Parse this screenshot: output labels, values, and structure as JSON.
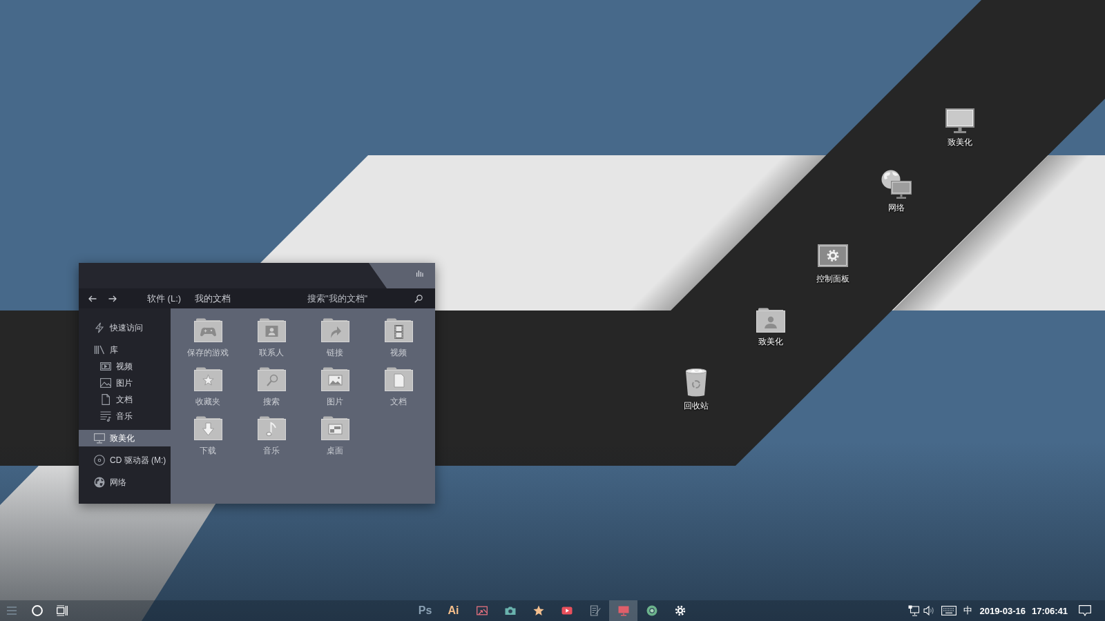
{
  "desktop": {
    "icons": [
      {
        "label": "致美化",
        "kind": "computer"
      },
      {
        "label": "网络",
        "kind": "network"
      },
      {
        "label": "控制面板",
        "kind": "control_panel"
      },
      {
        "label": "致美化",
        "kind": "user_folder"
      },
      {
        "label": "回收站",
        "kind": "recycle_bin"
      }
    ]
  },
  "explorer": {
    "breadcrumb": [
      "软件 (L:)",
      "我的文档"
    ],
    "search": {
      "placeholder": "搜索\"我的文档\""
    },
    "sidebar": {
      "items": [
        {
          "label": "快速访问",
          "kind": "quick_access",
          "selected": false
        },
        {
          "label": "库",
          "kind": "library",
          "selected": false,
          "children": [
            {
              "label": "视频",
              "kind": "video",
              "selected": false
            },
            {
              "label": "图片",
              "kind": "picture",
              "selected": false
            },
            {
              "label": "文档",
              "kind": "document",
              "selected": false
            },
            {
              "label": "音乐",
              "kind": "music",
              "selected": false
            }
          ]
        },
        {
          "label": "致美化",
          "kind": "computer",
          "selected": true
        },
        {
          "label": "CD 驱动器 (M:)",
          "kind": "disc",
          "selected": false
        },
        {
          "label": "网络",
          "kind": "network",
          "selected": false
        }
      ]
    },
    "folders": [
      {
        "label": "保存的游戏",
        "kind": "games"
      },
      {
        "label": "联系人",
        "kind": "contacts"
      },
      {
        "label": "链接",
        "kind": "links"
      },
      {
        "label": "视频",
        "kind": "videos"
      },
      {
        "label": "收藏夹",
        "kind": "favorites"
      },
      {
        "label": "搜索",
        "kind": "searches"
      },
      {
        "label": "图片",
        "kind": "pictures"
      },
      {
        "label": "文档",
        "kind": "documents"
      },
      {
        "label": "下载",
        "kind": "downloads"
      },
      {
        "label": "音乐",
        "kind": "music"
      },
      {
        "label": "桌面",
        "kind": "desktop"
      }
    ]
  },
  "taskbar": {
    "apps": [
      {
        "kind": "text",
        "label": "Ps",
        "color": "#8aa0b3",
        "selected": false
      },
      {
        "kind": "text",
        "label": "Ai",
        "color": "#f5bf8b",
        "selected": false
      },
      {
        "kind": "gallery",
        "color": "#e2707e",
        "selected": false
      },
      {
        "kind": "camera",
        "color": "#6ab3ae",
        "selected": false
      },
      {
        "kind": "star",
        "color": "#f5c08f",
        "selected": false
      },
      {
        "kind": "video",
        "color": "#e9505c",
        "selected": false
      },
      {
        "kind": "notes",
        "color": "#8f9ba6",
        "selected": false
      },
      {
        "kind": "monitor",
        "color": "#e05f6a",
        "selected": true
      },
      {
        "kind": "browser",
        "color": "#6cb38c",
        "selected": false
      },
      {
        "kind": "settings",
        "color": "#ffffff",
        "selected": false
      }
    ],
    "tray": {
      "input_method": "中",
      "date": "2019-03-16",
      "time": "17:06:41"
    }
  }
}
